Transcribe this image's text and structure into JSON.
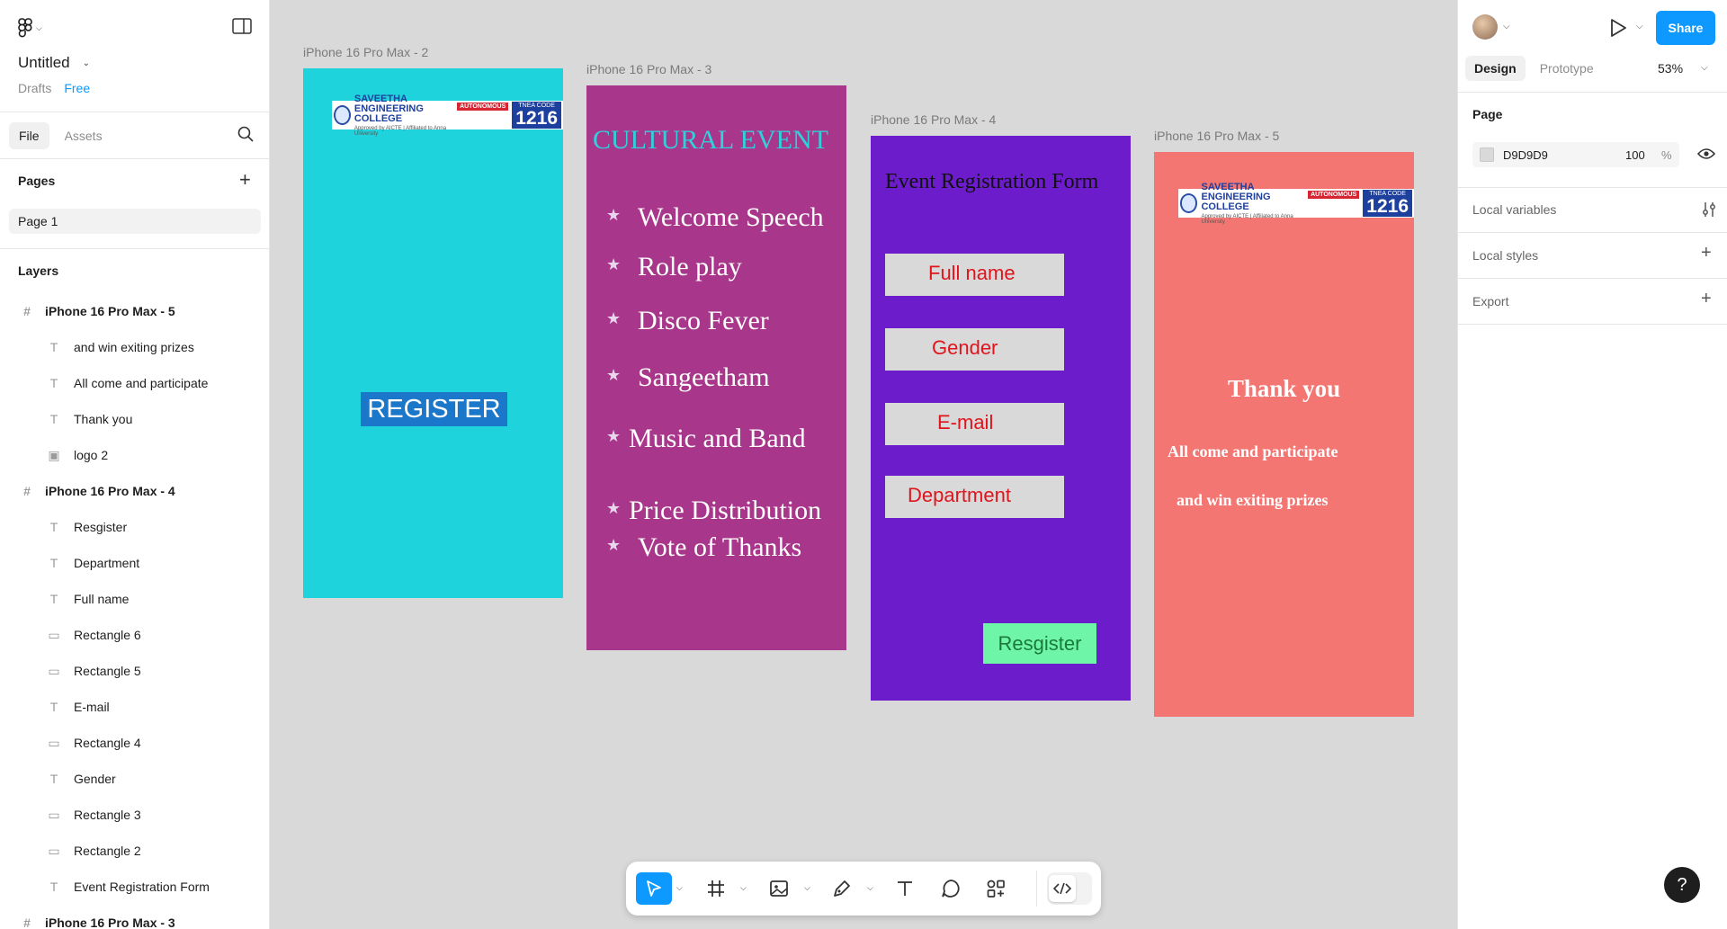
{
  "app": {
    "file_title": "Untitled",
    "drafts": "Drafts",
    "plan": "Free"
  },
  "left_panel": {
    "tabs": [
      "File",
      "Assets"
    ],
    "pages_title": "Pages",
    "pages": [
      "Page 1"
    ],
    "layers_title": "Layers",
    "layers": [
      {
        "label": "iPhone 16 Pro Max - 5",
        "kind": "frame"
      },
      {
        "label": "and win exiting prizes",
        "kind": "text"
      },
      {
        "label": "All come and participate",
        "kind": "text"
      },
      {
        "label": "Thank you",
        "kind": "text"
      },
      {
        "label": "logo 2",
        "kind": "image"
      },
      {
        "label": "iPhone 16 Pro Max - 4",
        "kind": "frame"
      },
      {
        "label": "Resgister",
        "kind": "text"
      },
      {
        "label": "Department",
        "kind": "text"
      },
      {
        "label": "Full name",
        "kind": "text"
      },
      {
        "label": "Rectangle 6",
        "kind": "rect"
      },
      {
        "label": "Rectangle 5",
        "kind": "rect"
      },
      {
        "label": "E-mail",
        "kind": "text"
      },
      {
        "label": "Rectangle 4",
        "kind": "rect"
      },
      {
        "label": "Gender",
        "kind": "text"
      },
      {
        "label": "Rectangle 3",
        "kind": "rect"
      },
      {
        "label": "Rectangle 2",
        "kind": "rect"
      },
      {
        "label": "Event Registration Form",
        "kind": "text"
      },
      {
        "label": "iPhone 16 Pro Max - 3",
        "kind": "frame"
      }
    ]
  },
  "canvas": {
    "frame2": {
      "label": "iPhone 16 Pro Max - 2",
      "bg": "#1ed3dc",
      "register": "REGISTER"
    },
    "frame3": {
      "label": "iPhone 16 Pro Max - 3",
      "bg": "#a8378b",
      "title": "CULTURAL EVENT",
      "items": [
        "Welcome Speech",
        "Role play",
        "Disco Fever",
        "Sangeetham",
        "Music and Band",
        "Price Distribution",
        "Vote of Thanks"
      ]
    },
    "frame4": {
      "label": "iPhone 16 Pro Max - 4",
      "bg": "#6c1ccb",
      "title": "Event Registration Form",
      "fields": [
        "Full name",
        "Gender",
        "E-mail",
        "Department"
      ],
      "button": "Resgister"
    },
    "frame5": {
      "label": "iPhone 16 Pro Max - 5",
      "bg": "#f47673",
      "thanks": "Thank you",
      "line1": "All come and participate",
      "line2": "and win exiting prizes"
    },
    "logo": {
      "name": "SAVEETHA",
      "name2": "ENGINEERING COLLEGE",
      "autonomous": "AUTONOMOUS",
      "approved": "Approved by AICTE | Affiliated to Anna University",
      "code_title": "TNEA CODE",
      "code": "1216"
    }
  },
  "right_panel": {
    "share": "Share",
    "tabs": [
      "Design",
      "Prototype"
    ],
    "zoom": "53%",
    "page_title": "Page",
    "fill_hex": "D9D9D9",
    "fill_opacity": "100",
    "fill_unit": "%",
    "local_variables": "Local variables",
    "local_styles": "Local styles",
    "export": "Export"
  },
  "help": "?"
}
